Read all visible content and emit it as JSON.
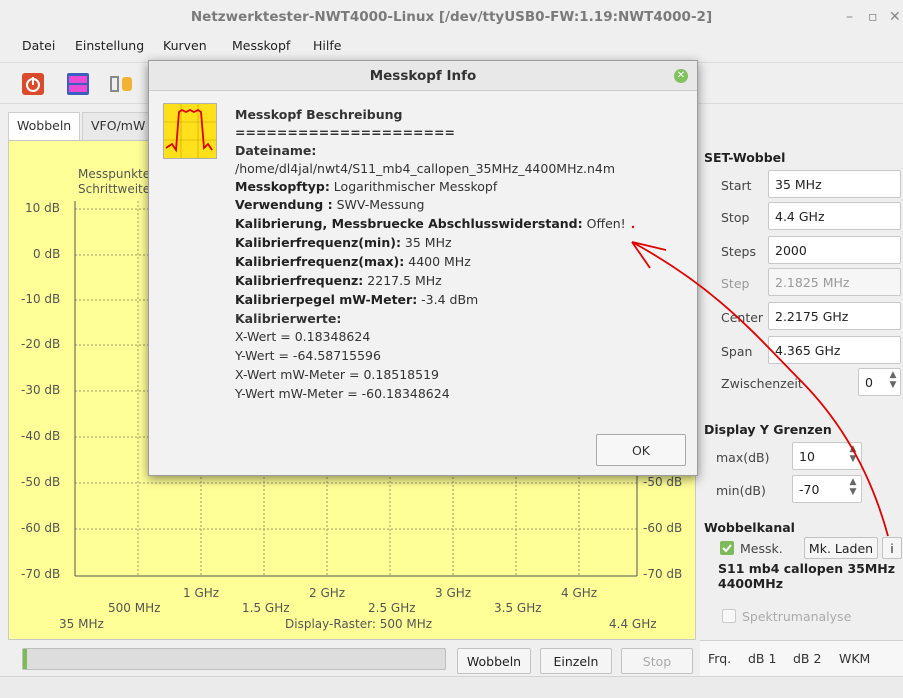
{
  "window": {
    "title": "Netzwerktester-NWT4000-Linux [/dev/ttyUSB0-FW:1.19:NWT4000-2]",
    "controls": [
      "–",
      "▫",
      "✕"
    ]
  },
  "menu": [
    "Datei",
    "Einstellung",
    "Kurven",
    "Messkopf",
    "Hilfe"
  ],
  "tabs": [
    {
      "label": "Wobbeln",
      "active": true
    },
    {
      "label": "VFO/mW"
    }
  ],
  "plot": {
    "left_labels": [
      "Messpunkte",
      "Schrittweite"
    ],
    "y_left": [
      "10 dB",
      "0 dB",
      "-10 dB",
      "-20 dB",
      "-30 dB",
      "-40 dB",
      "-50 dB",
      "-60 dB",
      "-70 dB"
    ],
    "y_right": [
      "-50 dB",
      "-60 dB",
      "-70 dB"
    ],
    "x_upper": [
      "1 GHz",
      "2 GHz",
      "3 GHz",
      "4 GHz"
    ],
    "x_lower": [
      "500 MHz",
      "1.5 GHz",
      "2.5 GHz",
      "3.5 GHz"
    ],
    "x_start": "35 MHz",
    "x_end": "4.4 GHz",
    "raster": "Display-Raster: 500 MHz"
  },
  "set_wobbel": {
    "title": "SET-Wobbel",
    "rows": [
      {
        "label": "Start",
        "value": "35 MHz"
      },
      {
        "label": "Stop",
        "value": "4.4 GHz"
      },
      {
        "label": "Steps",
        "value": "2000"
      },
      {
        "label": "Step",
        "value": "2.1825 MHz"
      },
      {
        "label": "Center",
        "value": "2.2175 GHz"
      },
      {
        "label": "Span",
        "value": "4.365 GHz"
      }
    ],
    "zwischenzeit_label": "Zwischenzeit",
    "zwischenzeit_value": "0"
  },
  "display_y": {
    "title": "Display Y Grenzen",
    "max_label": "max(dB)",
    "max_value": "10",
    "min_label": "min(dB)",
    "min_value": "-70"
  },
  "wobbelkanal": {
    "title": "Wobbelkanal",
    "messk_label": "Messk.",
    "mk_laden": "Mk. Laden",
    "info_btn": "i",
    "probe_name": "S11 mb4 callopen 35MHz 4400MHz",
    "spektrum": "Spektrumanalyse"
  },
  "bottom": {
    "progress": 0.01,
    "buttons": [
      "Wobbeln",
      "Einzeln",
      "Stop"
    ],
    "right_tabs": [
      "Frq.",
      "dB 1",
      "dB 2",
      "WKM"
    ]
  },
  "dialog": {
    "title": "Messkopf Info",
    "heading": "Messkopf Beschreibung",
    "separator": "=====================",
    "dateiname_label": "Dateiname:",
    "dateiname": "/home/dl4jal/nwt4/S11_mb4_callopen_35MHz_4400MHz.n4m",
    "lines": [
      {
        "label": "Messkopftyp:",
        "value": " Logarithmischer Messkopf"
      },
      {
        "label": "Verwendung :",
        "value": " SWV-Messung"
      },
      {
        "label": "Kalibrierung, Messbruecke Abschlusswiderstand:",
        "value": " Offen!"
      },
      {
        "label": "Kalibrierfrequenz(min):",
        "value": " 35 MHz"
      },
      {
        "label": "Kalibrierfrequenz(max):",
        "value": " 4400 MHz"
      },
      {
        "label": "Kalibrierfrequenz:",
        "value": " 2217.5 MHz"
      },
      {
        "label": "Kalibrierpegel mW-Meter:",
        "value": " -3.4 dBm"
      }
    ],
    "kalibrierwerte_label": "Kalibrierwerte:",
    "values": [
      "X-Wert = 0.18348624",
      "Y-Wert = -64.58715596",
      "X-Wert mW-Meter = 0.18518519",
      "Y-Wert mW-Meter = -60.18348624"
    ],
    "ok": "OK"
  },
  "colors": {
    "plot_bg": "#ffff98",
    "annotation": "#e00000",
    "progress": "#7dbb59"
  }
}
